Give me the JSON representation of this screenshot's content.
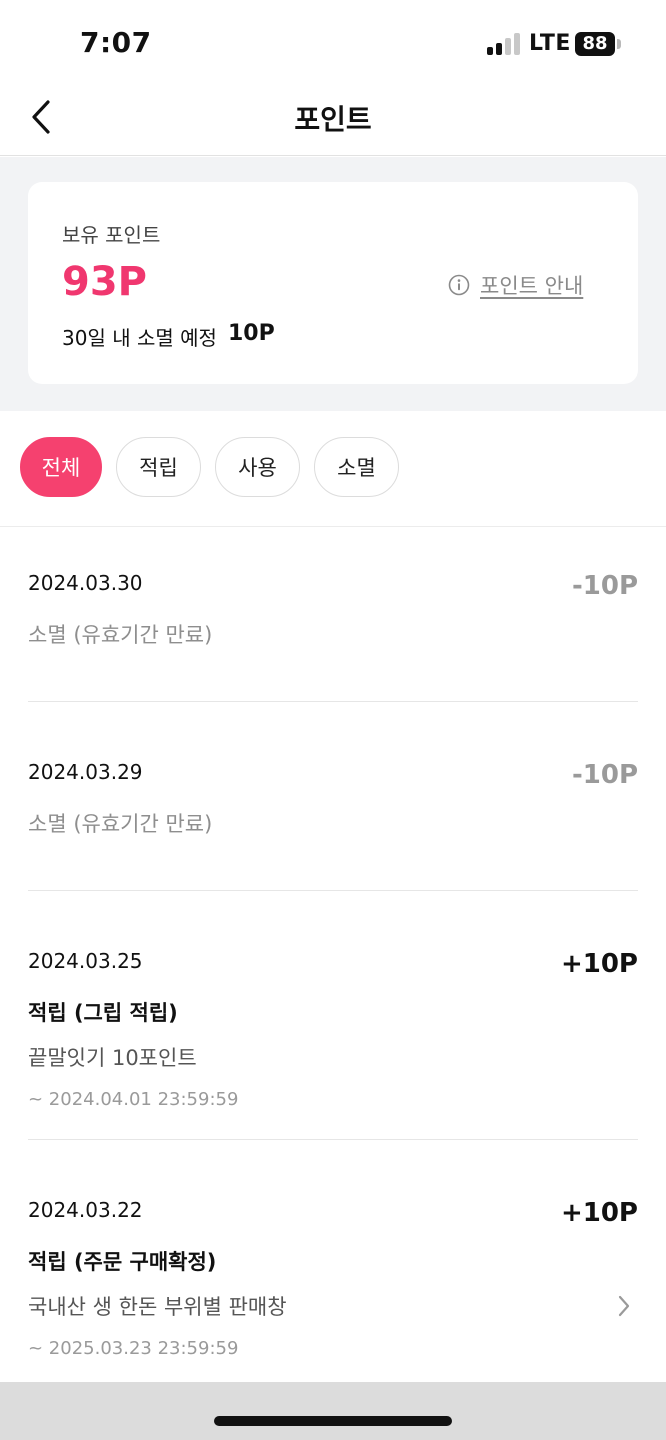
{
  "status_bar": {
    "time": "7:07",
    "network": "LTE",
    "battery": "88"
  },
  "header": {
    "title": "포인트"
  },
  "summary": {
    "label": "보유 포인트",
    "points": "93P",
    "expire_label": "30일 내 소멸 예정",
    "expire_value": "10P",
    "guide_link": "포인트 안내"
  },
  "filters": [
    {
      "label": "전체",
      "active": true
    },
    {
      "label": "적립",
      "active": false
    },
    {
      "label": "사용",
      "active": false
    },
    {
      "label": "소멸",
      "active": false
    }
  ],
  "history": [
    {
      "date": "2024.03.30",
      "amount": "-10P",
      "title": "소멸 (유효기간 만료)"
    },
    {
      "date": "2024.03.29",
      "amount": "-10P",
      "title": "소멸 (유효기간 만료)"
    },
    {
      "date": "2024.03.25",
      "amount": "+10P",
      "title": "적립 (그립 적립)",
      "desc": "끝말잇기 10포인트",
      "expiry": "~ 2024.04.01 23:59:59"
    },
    {
      "date": "2024.03.22",
      "amount": "+10P",
      "title": "적립 (주문 구매확정)",
      "desc": "국내산 생 한돈 부위별 판매창",
      "expiry": "~ 2025.03.23 23:59:59"
    }
  ],
  "colors": {
    "accent": "#f5416f",
    "points": "#f0376f"
  }
}
